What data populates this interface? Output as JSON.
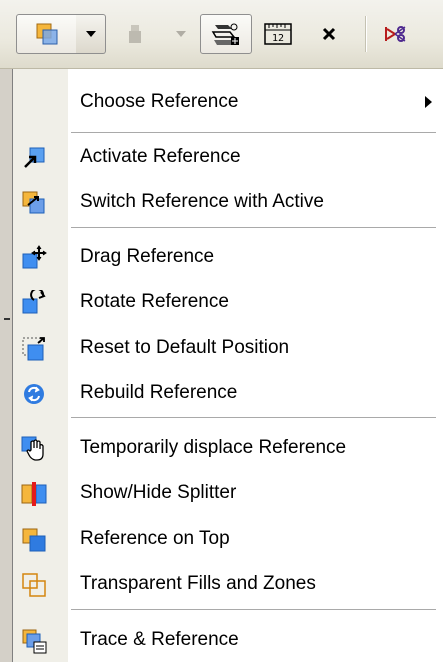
{
  "toolbar": {
    "buttons": [
      {
        "name": "reference-main-button",
        "icon": "reference-stack-icon"
      },
      {
        "name": "reference-dropdown-button",
        "icon": "chevron-down-icon"
      },
      {
        "name": "trace-disabled-button",
        "icon": "trace-disabled-icon"
      },
      {
        "name": "trace-dropdown-button",
        "icon": "chevron-down-icon"
      },
      {
        "name": "reference-settings-button",
        "icon": "reference-settings-icon"
      },
      {
        "name": "ruler-button",
        "icon": "ruler-icon"
      },
      {
        "name": "close-reference-button",
        "icon": "close-icon"
      },
      {
        "name": "cut-reference-button",
        "icon": "scissors-icon"
      }
    ]
  },
  "menu": {
    "items": [
      {
        "label": "Choose Reference",
        "icon": "",
        "submenu": true
      },
      {
        "label": "Activate Reference",
        "icon": "activate-arrow-icon"
      },
      {
        "label": "Switch Reference with Active",
        "icon": "switch-icon"
      },
      {
        "label": "Drag Reference",
        "icon": "drag-move-icon"
      },
      {
        "label": "Rotate Reference",
        "icon": "rotate-icon"
      },
      {
        "label": "Reset to Default Position",
        "icon": "reset-position-icon"
      },
      {
        "label": "Rebuild Reference",
        "icon": "rebuild-icon"
      },
      {
        "label": "Temporarily displace Reference",
        "icon": "hand-icon"
      },
      {
        "label": "Show/Hide Splitter",
        "icon": "splitter-icon"
      },
      {
        "label": "Reference on Top",
        "icon": "reference-on-top-icon"
      },
      {
        "label": "Transparent Fills and Zones",
        "icon": "transparent-fills-icon"
      },
      {
        "label": "Trace & Reference",
        "icon": "trace-reference-icon"
      }
    ]
  },
  "colors": {
    "menu_bg": "#ffffff",
    "gutter_bg": "#f0efe8",
    "toolbar_bg": "#ebe9de",
    "icon_orange": "#f5b63c",
    "icon_blue": "#2f7be0"
  }
}
